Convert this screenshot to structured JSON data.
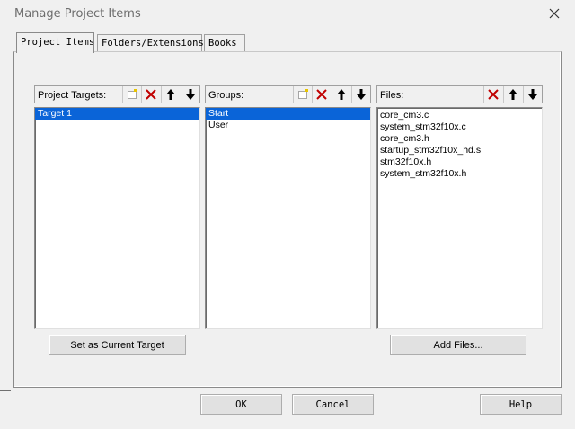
{
  "window": {
    "title": "Manage Project Items"
  },
  "tabs": [
    {
      "label": "Project Items",
      "active": true
    },
    {
      "label": "Folders/Extensions",
      "active": false
    },
    {
      "label": "Books",
      "active": false
    }
  ],
  "targets_pane": {
    "label": "Project Targets:",
    "toolbar": [
      "new-icon",
      "delete-icon",
      "move-up-icon",
      "move-down-icon"
    ],
    "items": [
      {
        "text": "Target 1",
        "selected": true
      }
    ],
    "button_label": "Set as Current Target"
  },
  "groups_pane": {
    "label": "Groups:",
    "toolbar": [
      "new-icon",
      "delete-icon",
      "move-up-icon",
      "move-down-icon"
    ],
    "items": [
      {
        "text": "Start",
        "selected": true
      },
      {
        "text": "User",
        "selected": false
      }
    ]
  },
  "files_pane": {
    "label": "Files:",
    "toolbar": [
      "delete-icon",
      "move-up-icon",
      "move-down-icon"
    ],
    "items": [
      {
        "text": "core_cm3.c",
        "selected": false
      },
      {
        "text": "system_stm32f10x.c",
        "selected": false
      },
      {
        "text": "core_cm3.h",
        "selected": false
      },
      {
        "text": "startup_stm32f10x_hd.s",
        "selected": false
      },
      {
        "text": "stm32f10x.h",
        "selected": false
      },
      {
        "text": "system_stm32f10x.h",
        "selected": false
      }
    ],
    "button_label": "Add Files..."
  },
  "footer": {
    "ok_label": "OK",
    "cancel_label": "Cancel",
    "help_label": "Help"
  },
  "colors": {
    "selection": "#0a64d8",
    "delete_red": "#c00000",
    "window_bg": "#f0f0f0"
  }
}
